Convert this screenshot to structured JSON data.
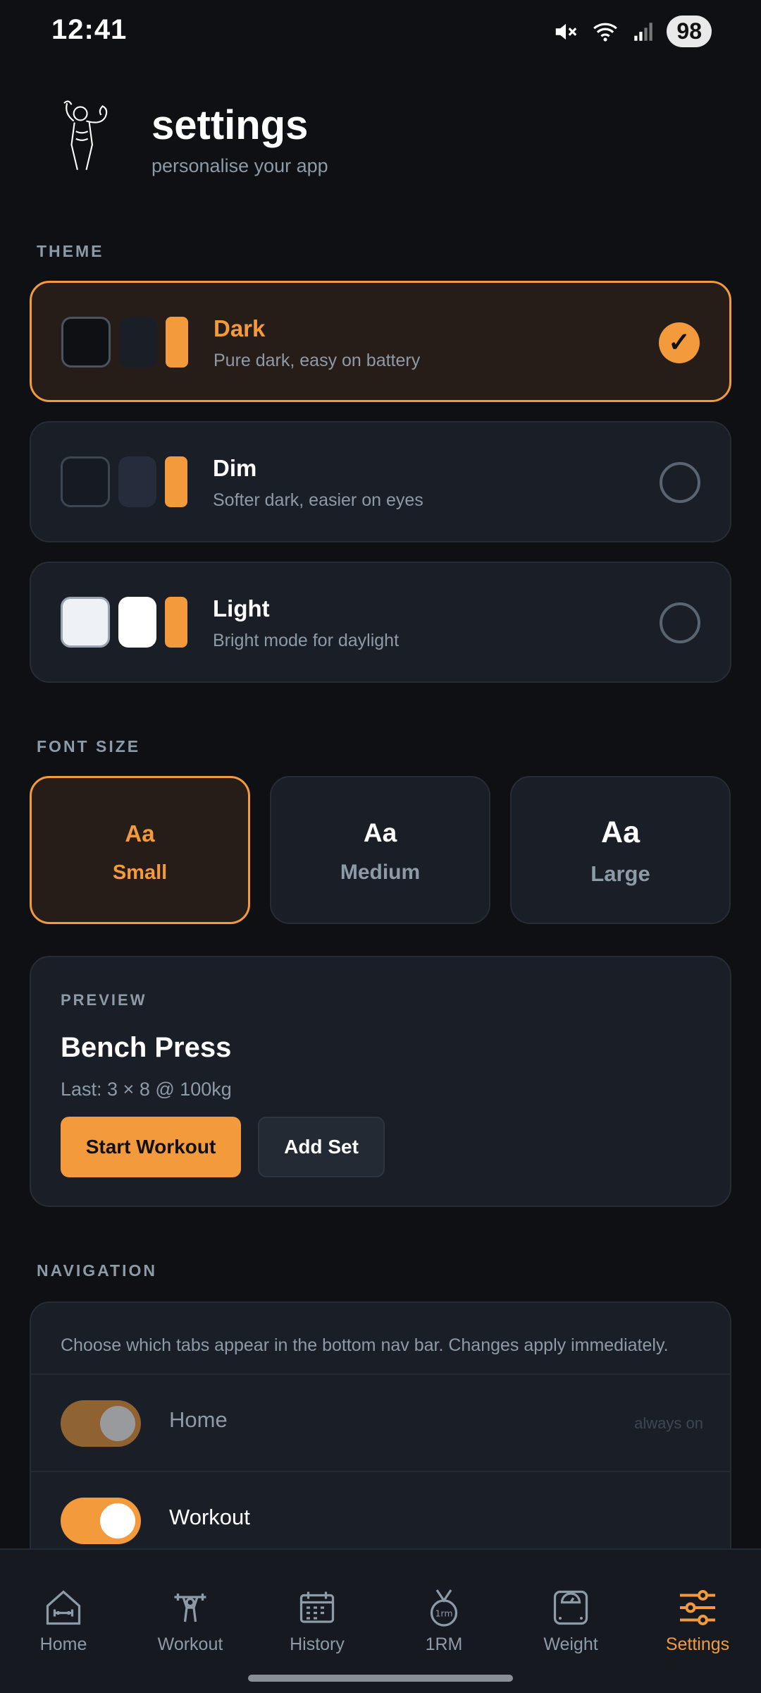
{
  "status": {
    "time": "12:41",
    "battery": "98"
  },
  "header": {
    "title": "settings",
    "subtitle": "personalise your app"
  },
  "theme": {
    "label": "THEME",
    "options": [
      {
        "name": "Dark",
        "desc": "Pure dark, easy on battery",
        "selected": true
      },
      {
        "name": "Dim",
        "desc": "Softer dark, easier on eyes",
        "selected": false
      },
      {
        "name": "Light",
        "desc": "Bright mode for daylight",
        "selected": false
      }
    ]
  },
  "font_size": {
    "label": "FONT SIZE",
    "options": [
      {
        "sample": "Aa",
        "label": "Small",
        "selected": true
      },
      {
        "sample": "Aa",
        "label": "Medium",
        "selected": false
      },
      {
        "sample": "Aa",
        "label": "Large",
        "selected": false
      }
    ]
  },
  "preview": {
    "label": "PREVIEW",
    "exercise": "Bench Press",
    "last": "Last: 3 × 8 @ 100kg",
    "primary_button": "Start Workout",
    "secondary_button": "Add Set"
  },
  "navigation": {
    "label": "NAVIGATION",
    "description": "Choose which tabs appear in the bottom nav bar. Changes apply immediately.",
    "items": [
      {
        "name": "Home",
        "note": "always on",
        "enabled": true
      },
      {
        "name": "Workout",
        "note": "",
        "enabled": true
      }
    ]
  },
  "bottom_nav": {
    "tabs": [
      {
        "label": "Home",
        "icon": "house-dumbbell-icon"
      },
      {
        "label": "Workout",
        "icon": "barbell-person-icon"
      },
      {
        "label": "History",
        "icon": "calendar-icon"
      },
      {
        "label": "1RM",
        "icon": "medal-icon"
      },
      {
        "label": "Weight",
        "icon": "scale-icon"
      },
      {
        "label": "Settings",
        "icon": "sliders-icon",
        "active": true
      }
    ]
  },
  "colors": {
    "accent": "#f29a3c",
    "background": "#0e1013",
    "card": "#1a1f27",
    "muted": "#8d9aa7"
  }
}
